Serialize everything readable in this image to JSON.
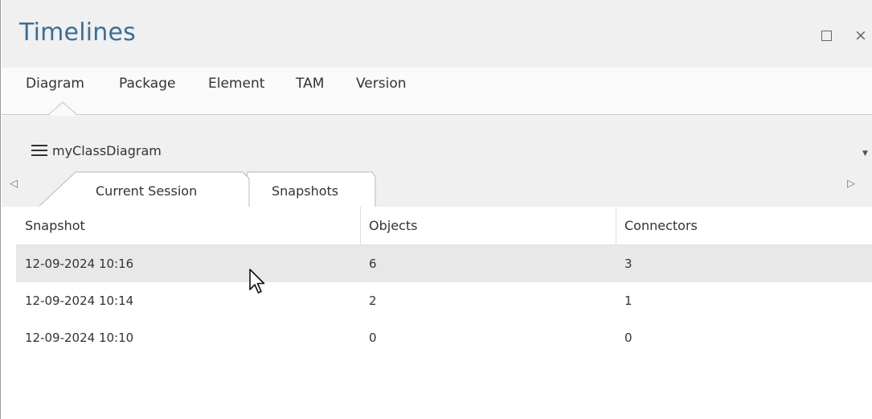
{
  "window": {
    "title": "Timelines",
    "maximize_icon": "maximize-icon",
    "close_glyph": "×"
  },
  "nav": {
    "items": [
      "Diagram",
      "Package",
      "Element",
      "TAM",
      "Version"
    ],
    "active": "Diagram"
  },
  "diagram_selector": {
    "icon": "hamburger-icon",
    "name": "myClassDiagram"
  },
  "tabs": {
    "items": [
      "Current Session",
      "Snapshots"
    ],
    "active": "Current Session",
    "scroll_left_glyph": "◁",
    "scroll_right_glyph": "▷"
  },
  "grid": {
    "columns": [
      "Snapshot",
      "Objects",
      "Connectors"
    ],
    "rows": [
      {
        "snapshot": "12-09-2024 10:16",
        "objects": "6",
        "connectors": "3",
        "selected": true
      },
      {
        "snapshot": "12-09-2024 10:14",
        "objects": "2",
        "connectors": "1",
        "selected": false
      },
      {
        "snapshot": "12-09-2024 10:10",
        "objects": "0",
        "connectors": "0",
        "selected": false
      }
    ]
  },
  "colors": {
    "title": "#3c6f94",
    "selected_row": "#e8e8e8",
    "chrome": "#f0f0f0"
  }
}
